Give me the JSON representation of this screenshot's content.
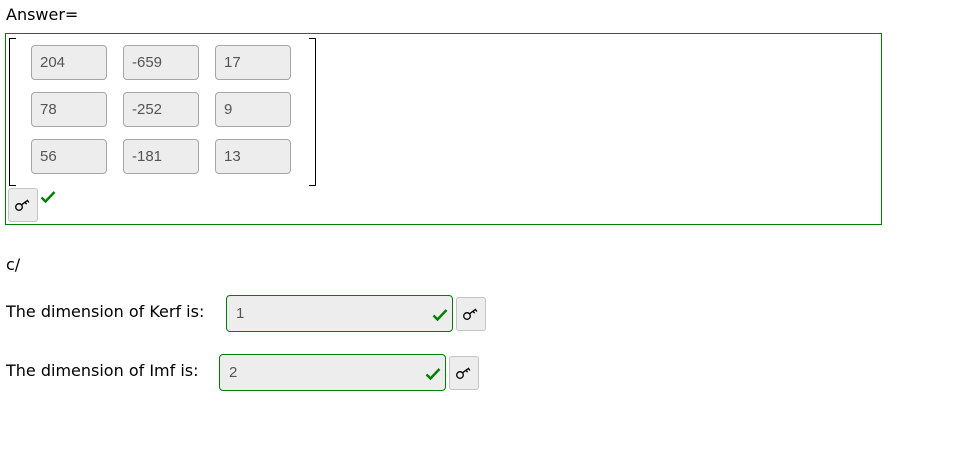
{
  "answer": {
    "label": "Answer=",
    "matrix": [
      [
        "204",
        "-659",
        "17"
      ],
      [
        "78",
        "-252",
        "9"
      ],
      [
        "56",
        "-181",
        "13"
      ]
    ],
    "status": "correct"
  },
  "section_c": {
    "label": "c/",
    "kerf": {
      "label": "The dimension of Kerf is:",
      "value": "1",
      "status": "correct"
    },
    "imf": {
      "label": "The dimension of Imf is:",
      "value": "2",
      "status": "correct"
    }
  },
  "icons": {
    "key": "key-icon",
    "check": "checkmark-icon"
  },
  "colors": {
    "correct": "#008000",
    "field_bg": "#ededed",
    "field_text": "#555555"
  }
}
